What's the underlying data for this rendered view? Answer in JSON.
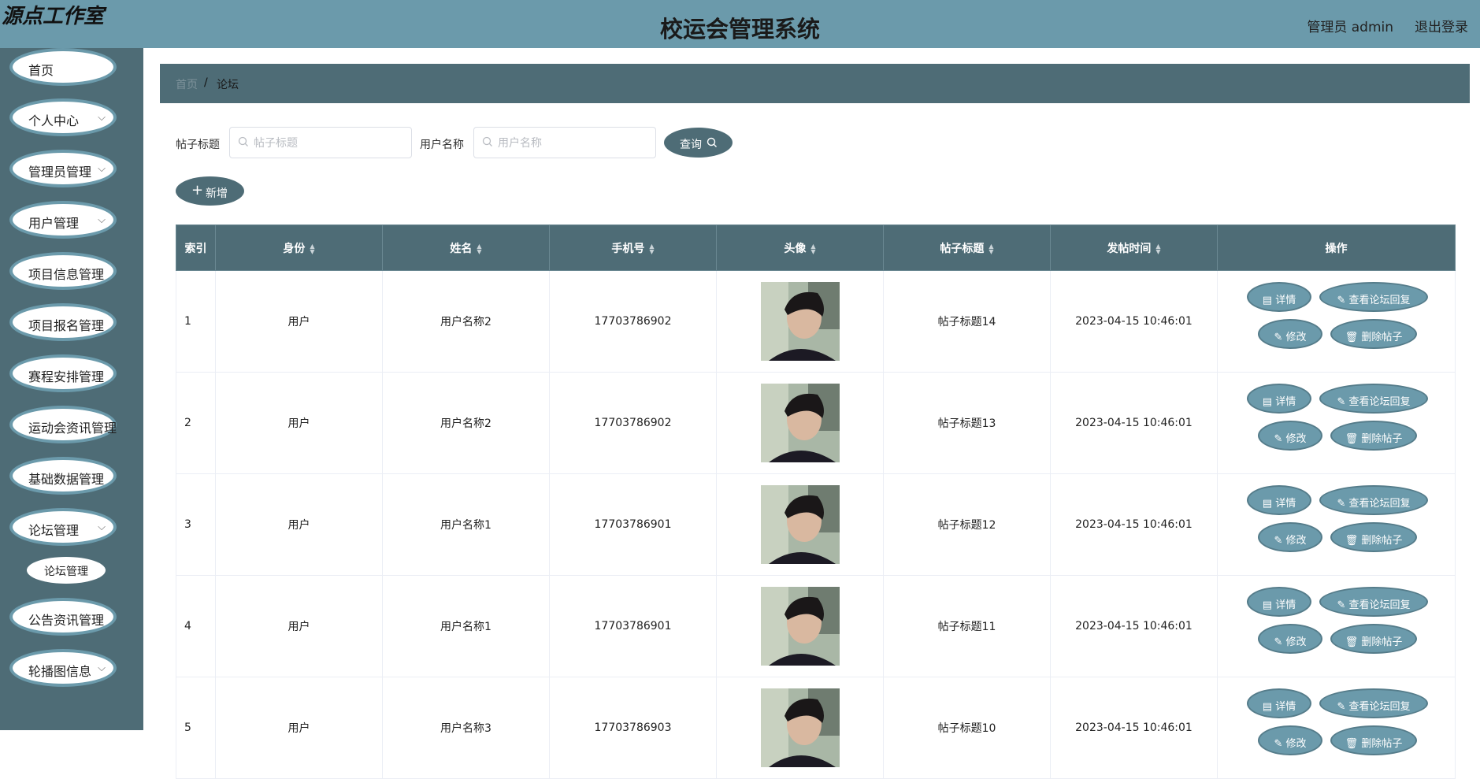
{
  "header": {
    "brand": "源点工作室",
    "title": "校运会管理系统",
    "admin_label": "管理员 admin",
    "logout": "退出登录",
    "bg_color": "#6b9aab"
  },
  "sidebar": {
    "bg_color": "#4e6c76",
    "items": [
      {
        "label": "首页"
      },
      {
        "label": "个人中心"
      },
      {
        "label": "管理员管理"
      },
      {
        "label": "用户管理"
      },
      {
        "label": "项目信息管理"
      },
      {
        "label": "项目报名管理"
      },
      {
        "label": "赛程安排管理"
      },
      {
        "label": "运动会资讯管理"
      },
      {
        "label": "基础数据管理"
      },
      {
        "label": "论坛管理"
      },
      {
        "label": "公告资讯管理"
      },
      {
        "label": "轮播图信息"
      }
    ],
    "sub_items": [
      {
        "label": "论坛管理"
      }
    ]
  },
  "breadcrumb": {
    "home": "首页",
    "separator": "/",
    "current": "论坛"
  },
  "search": {
    "title_label": "帖子标题",
    "title_placeholder": "帖子标题",
    "user_label": "用户名称",
    "user_placeholder": "用户名称",
    "query_button": "查询"
  },
  "toolbar": {
    "add_button": "新增"
  },
  "table": {
    "headers": {
      "index": "索引",
      "role": "身份",
      "name": "姓名",
      "phone": "手机号",
      "avatar": "头像",
      "post_title": "帖子标题",
      "post_time": "发帖时间",
      "actions": "操作"
    },
    "action_labels": {
      "detail": "详情",
      "view_replies": "查看论坛回复",
      "edit": "修改",
      "delete": "删除帖子"
    },
    "rows": [
      {
        "index": "1",
        "role": "用户",
        "name": "用户名称2",
        "phone": "17703786902",
        "post_title": "帖子标题14",
        "post_time": "2023-04-15 10:46:01"
      },
      {
        "index": "2",
        "role": "用户",
        "name": "用户名称2",
        "phone": "17703786902",
        "post_title": "帖子标题13",
        "post_time": "2023-04-15 10:46:01"
      },
      {
        "index": "3",
        "role": "用户",
        "name": "用户名称1",
        "phone": "17703786901",
        "post_title": "帖子标题12",
        "post_time": "2023-04-15 10:46:01"
      },
      {
        "index": "4",
        "role": "用户",
        "name": "用户名称1",
        "phone": "17703786901",
        "post_title": "帖子标题11",
        "post_time": "2023-04-15 10:46:01"
      },
      {
        "index": "5",
        "role": "用户",
        "name": "用户名称3",
        "phone": "17703786903",
        "post_title": "帖子标题10",
        "post_time": "2023-04-15 10:46:01"
      }
    ]
  }
}
